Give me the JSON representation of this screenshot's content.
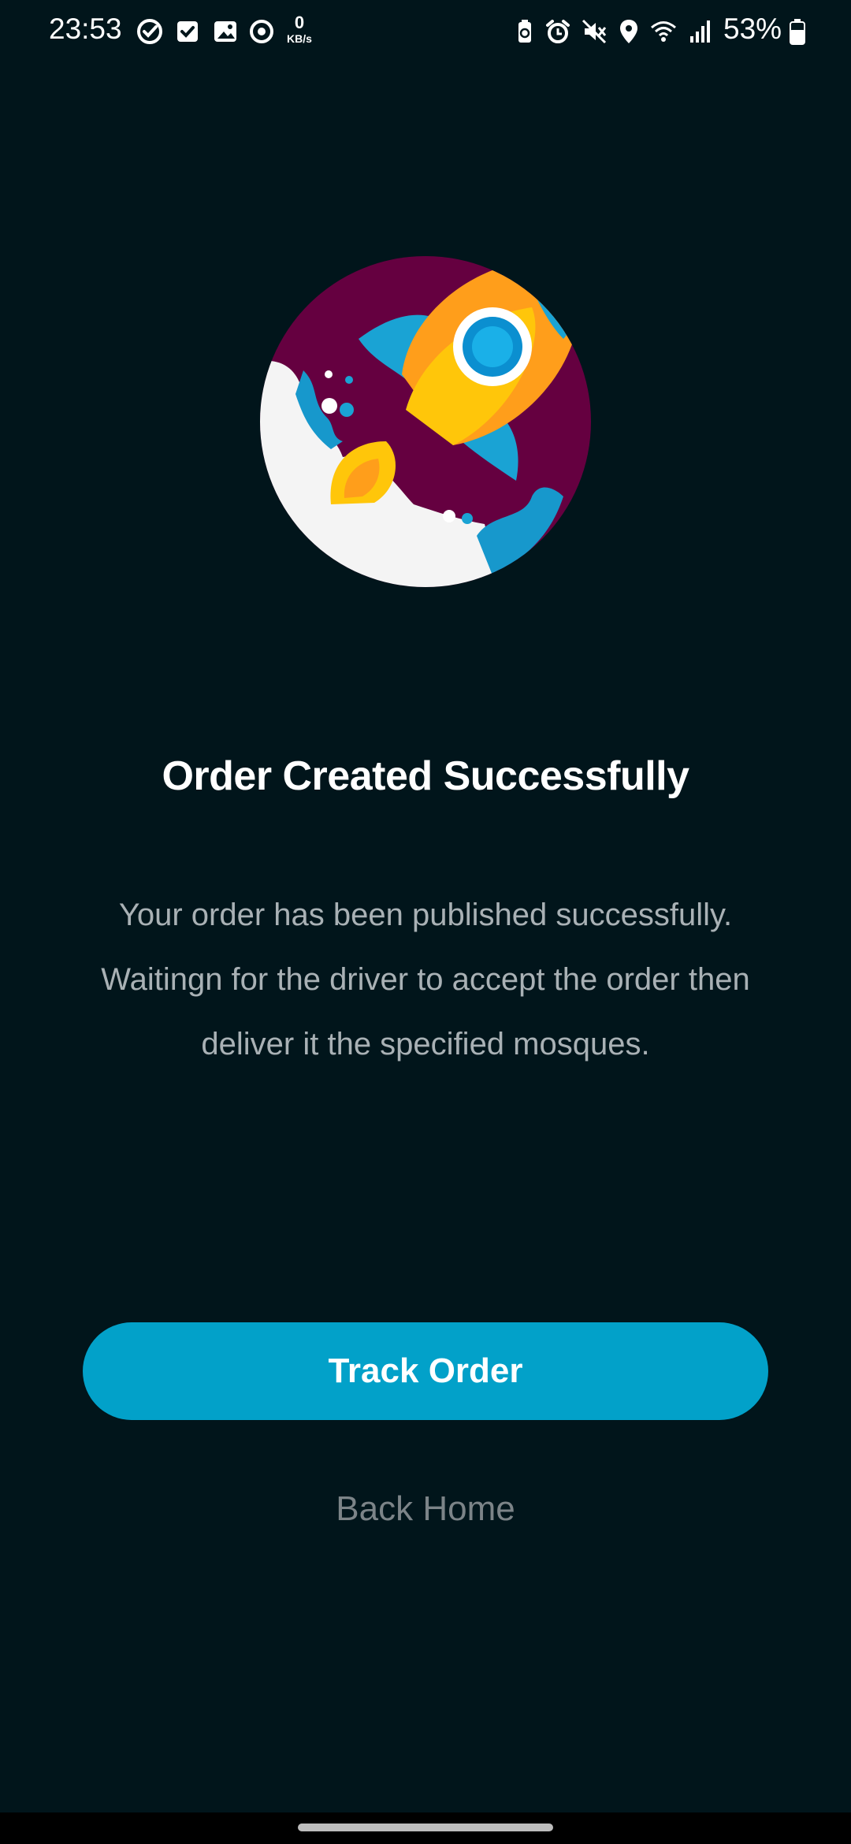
{
  "status_bar": {
    "time": "23:53",
    "net_speed_value": "0",
    "net_speed_unit": "KB/s",
    "battery_percent": "53%",
    "left_icons": [
      "check-circle-icon",
      "checkbox-icon",
      "gallery-icon",
      "sync-icon"
    ],
    "right_icons": [
      "battery-saver-icon",
      "alarm-icon",
      "mute-icon",
      "location-icon",
      "wifi-icon",
      "signal-icon",
      "battery-icon"
    ]
  },
  "illustration": {
    "name": "rocket-launch-icon",
    "colors": {
      "circle": "#650040",
      "cloud": "#f5f5f5",
      "rocket_body": "#ffc60a",
      "rocket_accent": "#ff9e1b",
      "rocket_blue": "#1aa3d4",
      "window": "#0b8fd0"
    }
  },
  "content": {
    "title": "Order Created Successfully",
    "message_line1": "Your order has been published successfully.",
    "message_line2": "Waitingn for the driver to accept the order then",
    "message_line3": "deliver it the specified mosques."
  },
  "actions": {
    "track_order_label": "Track Order",
    "back_home_label": "Back Home"
  },
  "colors": {
    "background": "#01151b",
    "primary": "#02a1c9",
    "muted_text": "#a9b1b5"
  }
}
